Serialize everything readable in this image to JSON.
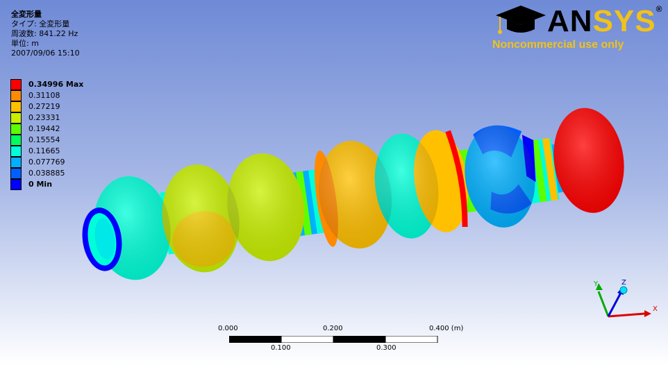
{
  "result_info": {
    "title": "全変形量",
    "type_line": "タイプ: 全変形量",
    "frequency_line": "周波数: 841.22 Hz",
    "unit_line": "単位: m",
    "date_line": "2007/09/06 15:10"
  },
  "legend": {
    "entries": [
      {
        "label": "0.34996 Max",
        "color": "#ff0000",
        "bold": true
      },
      {
        "label": "0.31108",
        "color": "#ff8a00",
        "bold": false
      },
      {
        "label": "0.27219",
        "color": "#ffc000",
        "bold": false
      },
      {
        "label": "0.23331",
        "color": "#c8f000",
        "bold": false
      },
      {
        "label": "0.19442",
        "color": "#5cff00",
        "bold": false
      },
      {
        "label": "0.15554",
        "color": "#00ff5c",
        "bold": false
      },
      {
        "label": "0.11665",
        "color": "#00ffd8",
        "bold": false
      },
      {
        "label": "0.077769",
        "color": "#00b0ff",
        "bold": false
      },
      {
        "label": "0.038885",
        "color": "#0060ff",
        "bold": false
      },
      {
        "label": "0 Min",
        "color": "#0000ff",
        "bold": true
      }
    ]
  },
  "logo": {
    "brand_a": "AN",
    "brand_b": "SYS",
    "registered": "®",
    "tagline": "Noncommercial use only"
  },
  "triad": {
    "x_label": "X",
    "y_label": "Y",
    "z_label": "Z"
  },
  "scale_bar": {
    "top_ticks": [
      "0.000",
      "0.200",
      "0.400 (m)"
    ],
    "bottom_ticks": [
      "0.100",
      "0.300"
    ]
  }
}
